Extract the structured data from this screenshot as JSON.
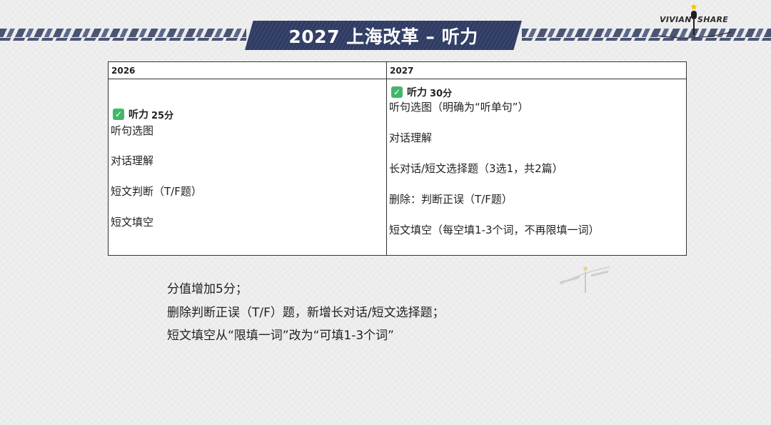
{
  "header": {
    "title": "2027 上海改革 – 听力",
    "logo_left": "VIVIAN",
    "logo_right": "SHARE",
    "band_color": "#2f3b63"
  },
  "table": {
    "col_2026": {
      "year": "2026",
      "heading_label": "听力",
      "heading_score": "25分",
      "items": [
        "听句选图",
        "对话理解",
        "短文判断（T/F题）",
        "短文填空"
      ]
    },
    "col_2027": {
      "year": "2027",
      "heading_label": "听力",
      "heading_score": "30分",
      "items": [
        "听句选图（明确为“听单句”）",
        "对话理解",
        "长对话/短文选择题（3选1，共2篇）",
        "删除：判断正误（T/F题）",
        "短文填空（每空填1-3个词，不再限填一词）"
      ]
    }
  },
  "summary": [
    "分值增加5分；",
    "删除判断正误（T/F）题，新增长对话/短文选择题；",
    "短文填空从“限填一词”改为“可填1-3个词”"
  ]
}
